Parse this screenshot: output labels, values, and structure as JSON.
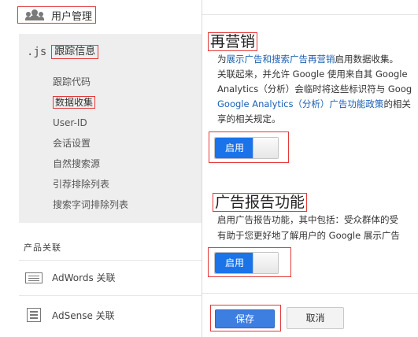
{
  "sidebar": {
    "top_item": {
      "label": "用户管理",
      "icon": "people-icon"
    },
    "js_item": {
      "icon_text": ".js",
      "label": "跟踪信息"
    },
    "sub_items": [
      {
        "label": "跟踪代码"
      },
      {
        "label": "数据收集"
      },
      {
        "label": "User-ID"
      },
      {
        "label": "会话设置"
      },
      {
        "label": "自然搜索源"
      },
      {
        "label": "引荐排除列表"
      },
      {
        "label": "搜索字词排除列表"
      }
    ],
    "section_title": "产品关联",
    "products": [
      {
        "label": "AdWords 关联",
        "icon": "adwords-icon"
      },
      {
        "label": "AdSense 关联",
        "icon": "adsense-icon"
      }
    ]
  },
  "remarketing": {
    "title": "再营销",
    "line1_prefix": "为",
    "line1_link": "展示广告和搜索广告再营销",
    "line1_suffix": "启用数据收集。",
    "line2": "关联起来，并允许 Google 使用来自其 Google",
    "line3": "Analytics（分析）会临时将这些标识符与 Goog",
    "line4_link": "Google Analytics（分析）广告功能政策",
    "line4_suffix": "的相关",
    "line5": "享的相关规定。",
    "toggle_label": "启用"
  },
  "ad_reporting": {
    "title": "广告报告功能",
    "line1": "启用广告报告功能，其中包括：受众群体的受",
    "line2": "有助于您更好地了解用户的 Google 展示广告",
    "toggle_label": "启用"
  },
  "actions": {
    "save_label": "保存",
    "cancel_label": "取消"
  },
  "colors": {
    "accent_blue": "#1a73e8",
    "link_blue": "#1a5fb4",
    "annotation_red": "#e23a3a"
  }
}
